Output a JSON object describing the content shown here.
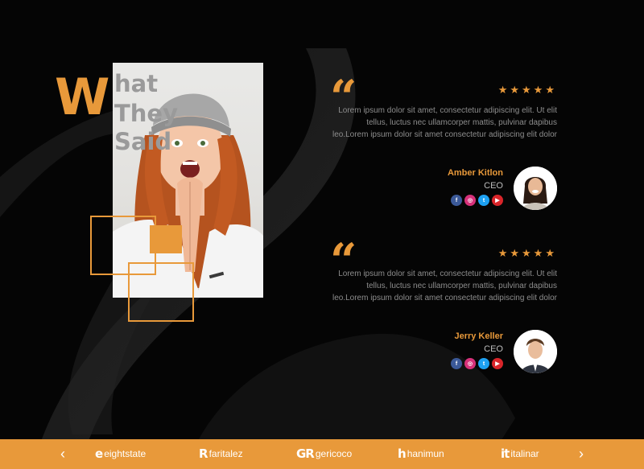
{
  "heading": {
    "first_letter": "W",
    "line1": "hat",
    "line2": "They",
    "line3": "Said"
  },
  "testimonials": [
    {
      "quote_mark": "“",
      "stars": "★★★★★",
      "text": "Lorem ipsum dolor sit amet, consectetur adipiscing elit. Ut elit tellus, luctus nec ullamcorper mattis, pulvinar dapibus leo.Lorem ipsum dolor sit amet consectetur adipiscing elit dolor",
      "name": "Amber Kitlon",
      "role": "CEO"
    },
    {
      "quote_mark": "“",
      "stars": "★★★★★",
      "text": "Lorem ipsum dolor sit amet, consectetur adipiscing elit. Ut elit tellus, luctus nec ullamcorper mattis, pulvinar dapibus leo.Lorem ipsum dolor sit amet consectetur adipiscing elit dolor",
      "name": "Jerry Keller",
      "role": "CEO"
    }
  ],
  "social_icons": [
    "facebook-icon",
    "instagram-icon",
    "twitter-icon",
    "youtube-icon"
  ],
  "footer": {
    "prev": "‹",
    "next": "›",
    "brands": [
      {
        "mark": "e",
        "name": "eightstate"
      },
      {
        "mark": "R",
        "name": "faritalez"
      },
      {
        "mark": "GR",
        "name": "gericoco"
      },
      {
        "mark": "h",
        "name": "hanimun"
      },
      {
        "mark": "it",
        "name": "italinar"
      }
    ]
  },
  "colors": {
    "accent": "#e8993a",
    "background": "#050505",
    "heading_gray": "#9a9a9a",
    "body_text": "#8d8d8d"
  }
}
